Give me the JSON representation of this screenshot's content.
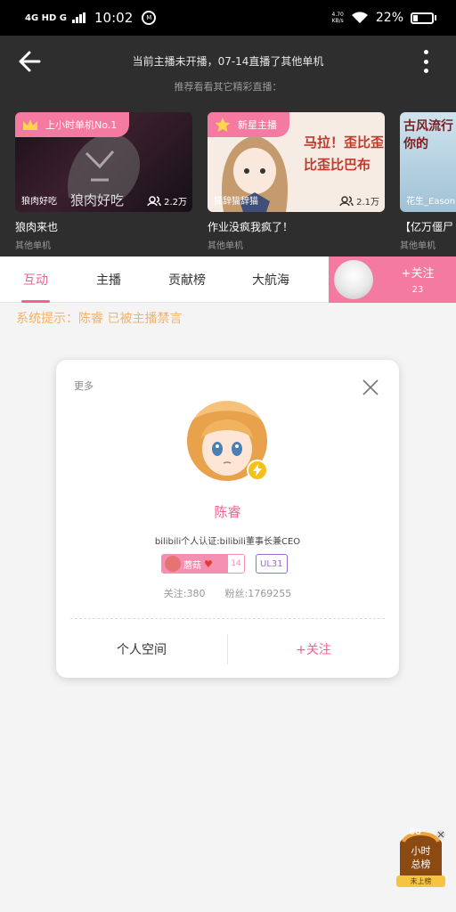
{
  "status_bar": {
    "network_label": "4G HD G",
    "time": "10:02",
    "app_badge": "M",
    "speed_value": "4.70",
    "speed_unit": "KB/s",
    "battery_percent": "22%",
    "battery_level": 0.22
  },
  "header": {
    "notice": "当前主播未开播，07-14直播了其他单机",
    "sub_notice": "推荐看看其它精彩直播："
  },
  "recommended_rooms": [
    {
      "tag": "上小时单机No.1",
      "streamer": "狼肉好吃",
      "viewers": "2.2万",
      "title": "狼肉来也",
      "category": "其他单机",
      "thumb_text": "狼肉好吃"
    },
    {
      "tag": "新星主播",
      "streamer": "猫辞猫辞猫",
      "viewers": "2.1万",
      "title": "作业没疯我疯了！",
      "category": "其他单机",
      "thumb_text": "马拉！歪比歪比歪比巴布"
    },
    {
      "tag": "",
      "streamer": "花生_Eason",
      "viewers": "",
      "title": "【亿万僵尸",
      "category": "其他单机",
      "thumb_text": "古风流行你的"
    }
  ],
  "tabs": [
    {
      "label": "互动",
      "active": true
    },
    {
      "label": "主播",
      "active": false
    },
    {
      "label": "贡献榜",
      "active": false
    },
    {
      "label": "大航海",
      "active": false
    }
  ],
  "follow_block": {
    "label": "+关注",
    "count": "23"
  },
  "system_message": "系统提示：陈睿 已被主播禁言",
  "profile_card": {
    "more_label": "更多",
    "name": "陈睿",
    "certification": "bilibili个人认证:bilibili董事长兼CEO",
    "medal_name": "蘑菇",
    "medal_level": "14",
    "user_level": "UL31",
    "following": "关注:380",
    "followers": "粉丝:1769255",
    "space_button": "个人空间",
    "follow_button": "+关注"
  },
  "rank_widget": {
    "badge": "60",
    "line1": "小时",
    "line2": "总榜",
    "status": "未上榜"
  },
  "colors": {
    "accent_pink": "#f06292",
    "follow_pink": "#f47aa1",
    "system_message": "#f3b26a",
    "top_panel": "#2e2e2e"
  }
}
